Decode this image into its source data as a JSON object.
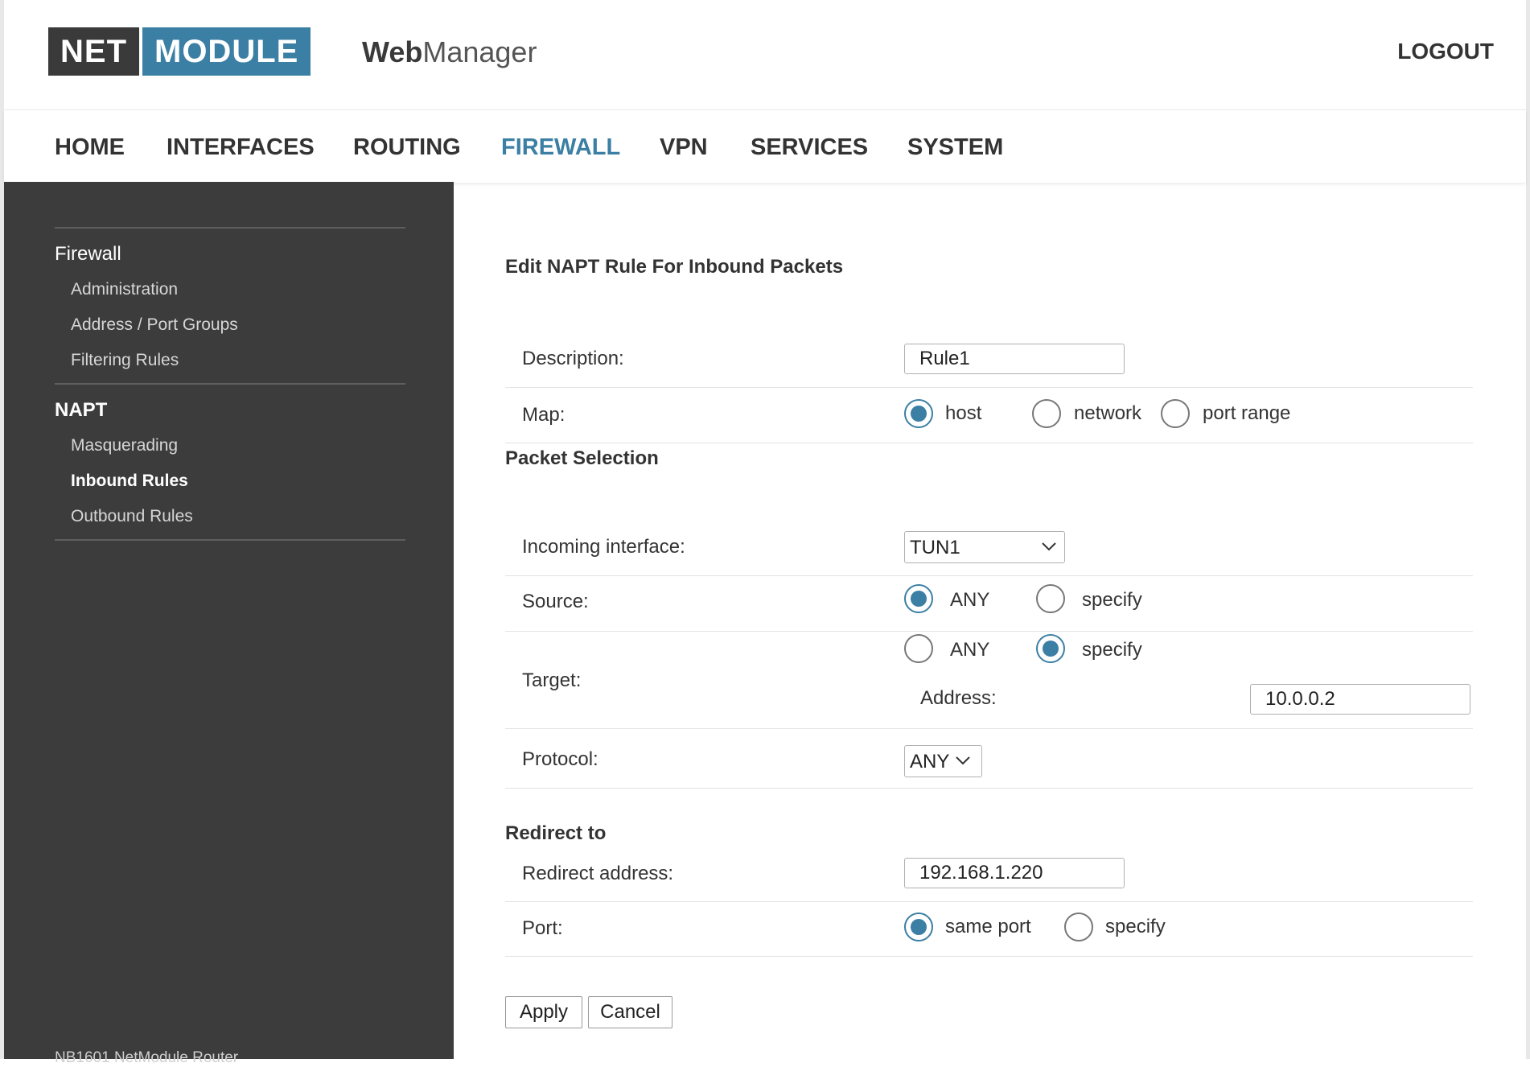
{
  "header": {
    "logo_left": "NET",
    "logo_right": "MODULE",
    "product_bold": "Web",
    "product_rest": "Manager",
    "logout": "LOGOUT"
  },
  "nav": {
    "items": [
      "HOME",
      "INTERFACES",
      "ROUTING",
      "FIREWALL",
      "VPN",
      "SERVICES",
      "SYSTEM"
    ],
    "active": "FIREWALL"
  },
  "sidebar": {
    "groups": [
      {
        "title": "Firewall",
        "items": [
          "Administration",
          "Address / Port Groups",
          "Filtering Rules"
        ]
      },
      {
        "title": "NAPT",
        "items": [
          "Masquerading",
          "Inbound Rules",
          "Outbound Rules"
        ]
      }
    ],
    "active_item": "Inbound Rules",
    "footer": "NB1601 NetModule Router"
  },
  "form": {
    "title": "Edit NAPT Rule For Inbound Packets",
    "description": {
      "label": "Description:",
      "value": "Rule1"
    },
    "map": {
      "label": "Map:",
      "options": [
        "host",
        "network",
        "port range"
      ],
      "selected": "host"
    },
    "packet_selection": {
      "title": "Packet Selection",
      "incoming_interface": {
        "label": "Incoming interface:",
        "value": "TUN1"
      },
      "source": {
        "label": "Source:",
        "options": [
          "ANY",
          "specify"
        ],
        "selected": "ANY"
      },
      "target": {
        "label": "Target:",
        "options": [
          "ANY",
          "specify"
        ],
        "selected": "specify",
        "address_label": "Address:",
        "address_value": "10.0.0.2"
      },
      "protocol": {
        "label": "Protocol:",
        "value": "ANY"
      }
    },
    "redirect": {
      "title": "Redirect to",
      "address": {
        "label": "Redirect address:",
        "value": "192.168.1.220"
      },
      "port": {
        "label": "Port:",
        "options": [
          "same port",
          "specify"
        ],
        "selected": "same port"
      }
    },
    "buttons": {
      "apply": "Apply",
      "cancel": "Cancel"
    }
  },
  "colors": {
    "accent": "#3b7fa4",
    "sidebar_bg": "#3c3c3c",
    "logo_dark": "#3a3a3a"
  }
}
